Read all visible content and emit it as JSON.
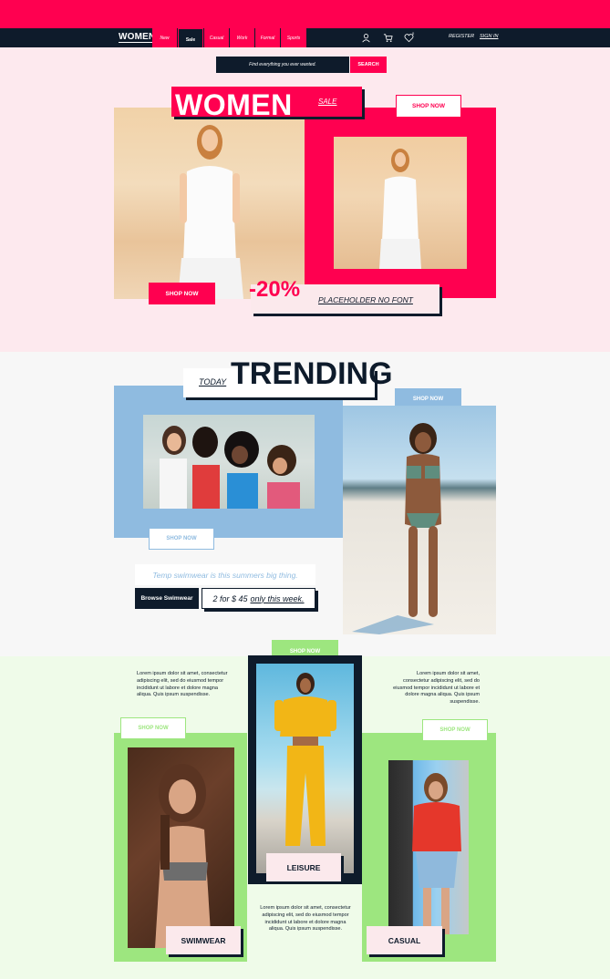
{
  "nav": {
    "brand": "WOMEN",
    "tabs": [
      {
        "label": "New"
      },
      {
        "label": "Sale"
      },
      {
        "label": "Casual"
      },
      {
        "label": "Work"
      },
      {
        "label": "Formal"
      },
      {
        "label": "Sports"
      }
    ],
    "active_tab": "Sale",
    "wishlist_count": "0",
    "register_label": "REGISTER",
    "signin_label": "SIGN IN"
  },
  "search": {
    "placeholder": "Find everything you ever wanted.",
    "button_label": "SEARCH"
  },
  "hero": {
    "title": "WOMEN",
    "sale_label": "SALE",
    "shop_now_top": "SHOP NOW",
    "shop_now_bottom": "SHOP NOW",
    "discount": "-20%",
    "discount_caption": "PLACEHOLDER NO FONT"
  },
  "trending": {
    "today_label": "TODAY",
    "title": "TRENDING",
    "shop_now_blue_1": "SHOP NOW",
    "shop_now_blue_2": "SHOP NOW",
    "tagline": "Temp swimwear is this summers big thing.",
    "browse_button": "Browse Swimwear",
    "offer": "2 for $ 45",
    "offer_suffix": "only this week."
  },
  "lower": {
    "shop_now_center": "SHOP NOW",
    "shop_now_left": "SHOP NOW",
    "shop_now_right": "SHOP NOW",
    "lorem_left": "Lorem ipsum dolor sit amet, consectetur adipiscing elit, sed do eiusmod tempor incididunt ut labore et dolore magna aliqua. Quis ipsum suspendisse.",
    "lorem_right": "Lorem ipsum dolor sit amet, consectetur adipiscing elit, sed do eiusmod tempor incididunt ut labore et dolore magna aliqua. Quis ipsum suspendisse.",
    "lorem_bottom": "Lorem ipsum dolor sit amet, consectetur adipiscing elit, sed do eiusmod tempor incididunt ut labore et dolore magna aliqua. Quis ipsum suspendisse.",
    "cat_swimwear": "SWIMWEAR",
    "cat_leisure": "LEISURE",
    "cat_casual": "CASUAL"
  },
  "colors": {
    "accent": "#ff0050",
    "navy": "#0e1b2b",
    "blue": "#8fbbe0",
    "green": "#9de67f"
  }
}
